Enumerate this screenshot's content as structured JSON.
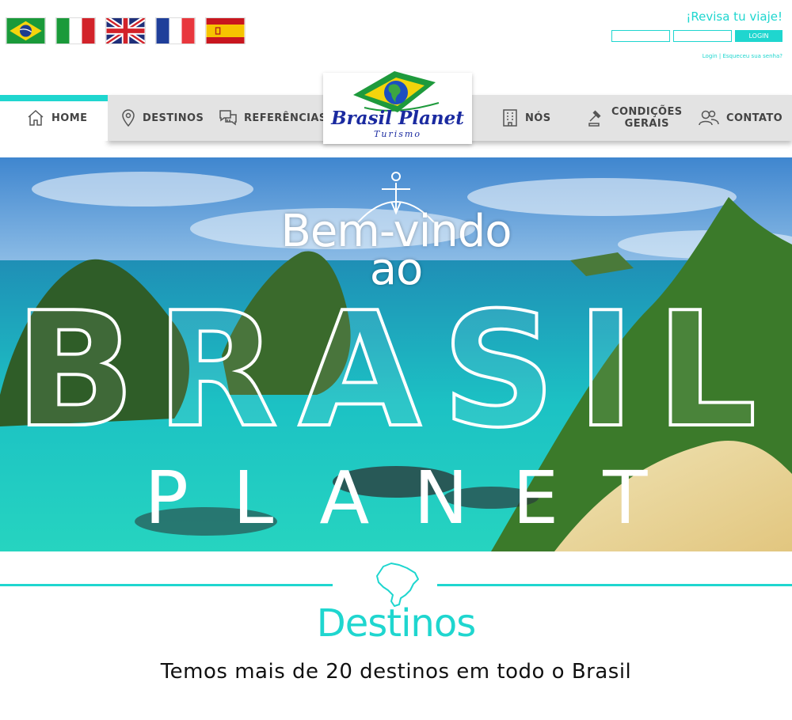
{
  "languages": [
    {
      "name": "brazil-flag"
    },
    {
      "name": "italy-flag"
    },
    {
      "name": "uk-flag"
    },
    {
      "name": "france-flag"
    },
    {
      "name": "spain-flag"
    }
  ],
  "login": {
    "title": "¡Revisa tu viaje!",
    "button": "LOGIN",
    "link_login": "Login",
    "separator": "|",
    "link_forgot": "Esqueceu sua senha?"
  },
  "nav": {
    "home": "HOME",
    "destinos": "DESTINOS",
    "referencias": "REFERÊNCIAS",
    "nos": "NÓS",
    "condicoes_line1": "CONDIÇÕES",
    "condicoes_line2": "GERAIS",
    "contato": "CONTATO"
  },
  "logo": {
    "brand": "Brasil Planet",
    "sub": "Turismo"
  },
  "hero": {
    "welcome_line1": "Bem-vindo",
    "welcome_line2": "ao",
    "brasil": "BRASIL",
    "planet": "PLANET"
  },
  "destinos": {
    "title": "Destinos",
    "subtitle": "Temos mais de 20 destinos em todo o Brasil"
  },
  "colors": {
    "accent": "#1fd6cf",
    "nav_bg": "#e3e3e3",
    "logo_blue": "#1a2aa0"
  }
}
